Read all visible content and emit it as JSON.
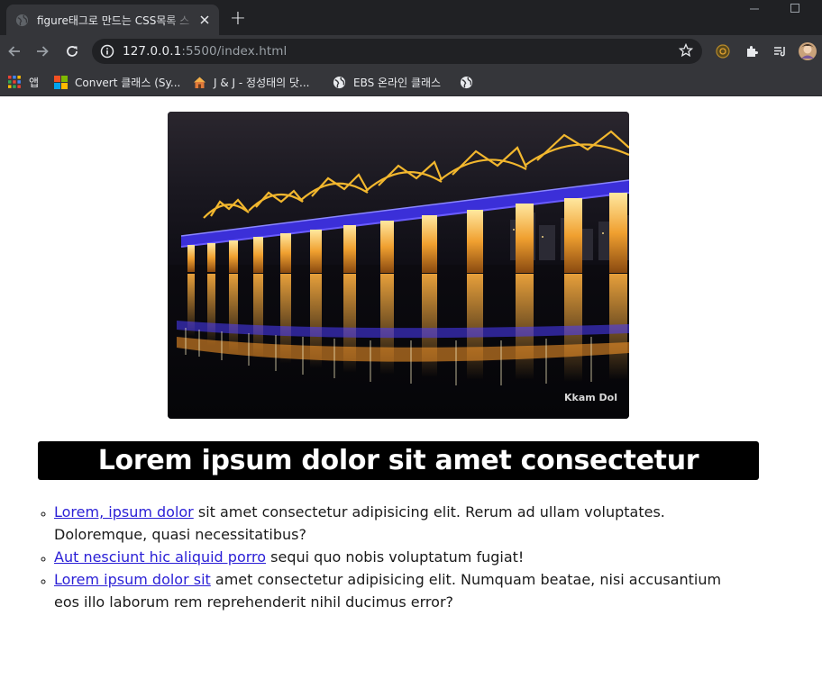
{
  "browser": {
    "tab": {
      "title": "figure태그로 만드는 CSS목록 스",
      "close": "✕"
    },
    "new_tab": "+",
    "window_controls": {
      "minimize": "—",
      "maximize": "☐"
    },
    "address": {
      "host": "127.0.0.1",
      "rest": ":5500/index.html"
    },
    "icons": [
      "globe-icon",
      "back-arrow-icon",
      "forward-arrow-icon",
      "reload-icon",
      "info-icon",
      "star-icon",
      "extension-icon",
      "puzzle-icon",
      "media-icon",
      "avatar"
    ],
    "bookmarks": [
      {
        "label": "앱",
        "icon": "apps-grid-icon"
      },
      {
        "label": "Convert 클래스 (Sy...",
        "icon": "microsoft-icon"
      },
      {
        "label": "J & J - 정성태의 닷...",
        "icon": "home-icon"
      },
      {
        "label": "EBS 온라인 클래스",
        "icon": "globe-icon"
      },
      {
        "label": "",
        "icon": "globe-icon"
      }
    ]
  },
  "page": {
    "figure": {
      "watermark": "Kkam Dol"
    },
    "heading": "Lorem ipsum dolor sit amet consectetur",
    "items": [
      {
        "link": "Lorem, ipsum dolor",
        "text": " sit amet consectetur adipisicing elit. Rerum ad ullam voluptates. Doloremque, quasi necessitatibus?"
      },
      {
        "link": "Aut nesciunt hic aliquid porro",
        "text": " sequi quo nobis voluptatum fugiat!"
      },
      {
        "link": "Lorem ipsum dolor sit",
        "text": " amet consectetur adipisicing elit. Numquam beatae, nisi accusantium eos illo laborum rem reprehenderit nihil ducimus error?"
      }
    ]
  },
  "colors": {
    "tabstrip": "#202124",
    "toolbar": "#35363a",
    "omnibox": "#202124",
    "link": "#2a1fd6",
    "heading_bg": "#000000"
  }
}
